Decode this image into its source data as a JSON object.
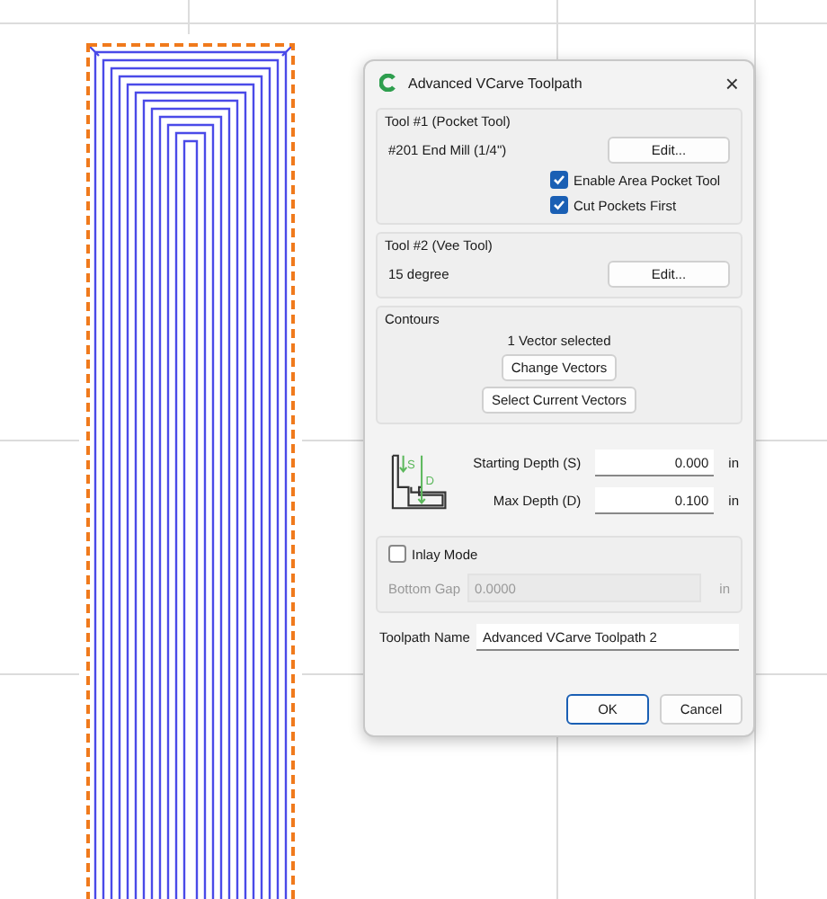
{
  "dialog": {
    "title": "Advanced VCarve Toolpath",
    "close": "×"
  },
  "tool1": {
    "legend": "Tool #1 (Pocket Tool)",
    "name": "#201 End Mill (1/4\")",
    "edit": "Edit...",
    "options": [
      {
        "label": "Enable Area Pocket Tool",
        "checked": true
      },
      {
        "label": "Cut Pockets First",
        "checked": true
      }
    ]
  },
  "tool2": {
    "legend": "Tool #2 (Vee Tool)",
    "name": "15 degree",
    "edit": "Edit..."
  },
  "contours": {
    "legend": "Contours",
    "status": "1 Vector selected",
    "buttons": [
      "Change Vectors",
      "Select Current Vectors"
    ]
  },
  "depths": {
    "s_label": "S",
    "d_label": "D",
    "fields": [
      {
        "label": "Starting Depth (S)",
        "value": "0.000",
        "unit": "in"
      },
      {
        "label": "Max Depth (D)",
        "value": "0.100",
        "unit": "in"
      }
    ]
  },
  "inlay": {
    "label": "Inlay Mode",
    "checked": false,
    "gap_label": "Bottom Gap",
    "gap_value": "0.0000",
    "gap_unit": "in",
    "disabled": true
  },
  "toolpath_name": {
    "label": "Toolpath Name",
    "value": "Advanced VCarve Toolpath 2"
  },
  "buttons": [
    "OK",
    "Cancel"
  ]
}
